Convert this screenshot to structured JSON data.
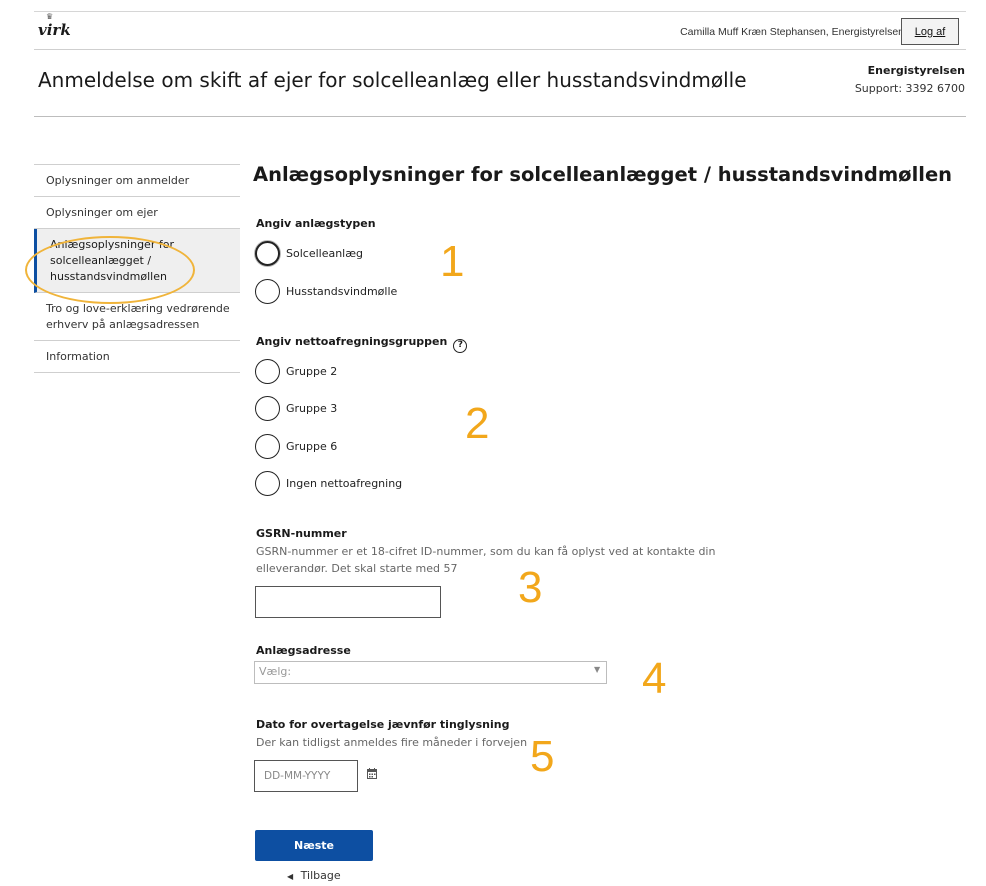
{
  "header": {
    "logo": "virk",
    "user": "Camilla Muff Kræn Stephansen, Energistyrelsen",
    "logout_label": "Log af",
    "app_title": "Anmeldelse om skift af ejer for solcelleanlæg eller husstandsvindmølle",
    "org_name": "Energistyrelsen",
    "support": "Support: 3392 6700"
  },
  "sidebar": {
    "items": [
      {
        "label": "Oplysninger om anmelder"
      },
      {
        "label": "Oplysninger om ejer"
      },
      {
        "label": "Anlægsoplysninger for solcelleanlægget / husstandsvindmøllen"
      },
      {
        "label": "Tro og love-erklæring vedrørende erhverv på anlægsadressen"
      },
      {
        "label": "Information"
      }
    ],
    "active_index": 2
  },
  "main": {
    "heading": "Anlægsoplysninger for solcelleanlægget / husstandsvindmøllen",
    "facility_type": {
      "label": "Angiv anlægstypen",
      "options": [
        "Solcelleanlæg",
        "Husstandsvindmølle"
      ]
    },
    "net_group": {
      "label": "Angiv nettoafregningsgruppen",
      "options": [
        "Gruppe 2",
        "Gruppe 3",
        "Gruppe 6",
        "Ingen nettoafregning"
      ]
    },
    "gsrn": {
      "label": "GSRN-nummer",
      "hint_line1": "GSRN-nummer er et 18-cifret ID-nummer, som du kan få oplyst ved at kontakte din",
      "hint_line2": "elleverandør. Det skal starte med 57",
      "value": ""
    },
    "address": {
      "label": "Anlægsadresse",
      "selected": "Vælg:"
    },
    "date": {
      "label": "Dato for overtagelse jævnfør tinglysning",
      "hint": "Der kan tidligst anmeldes fire måneder i forvejen",
      "placeholder": "DD-MM-YYYY"
    },
    "next_label": "Næste",
    "back_label": "Tilbage"
  },
  "annotations": {
    "step_numbers": [
      "1",
      "2",
      "3",
      "4",
      "5"
    ],
    "color": "#f2a71b"
  },
  "colors": {
    "primary": "#0d4fa2",
    "annotation": "#f2a71b"
  }
}
